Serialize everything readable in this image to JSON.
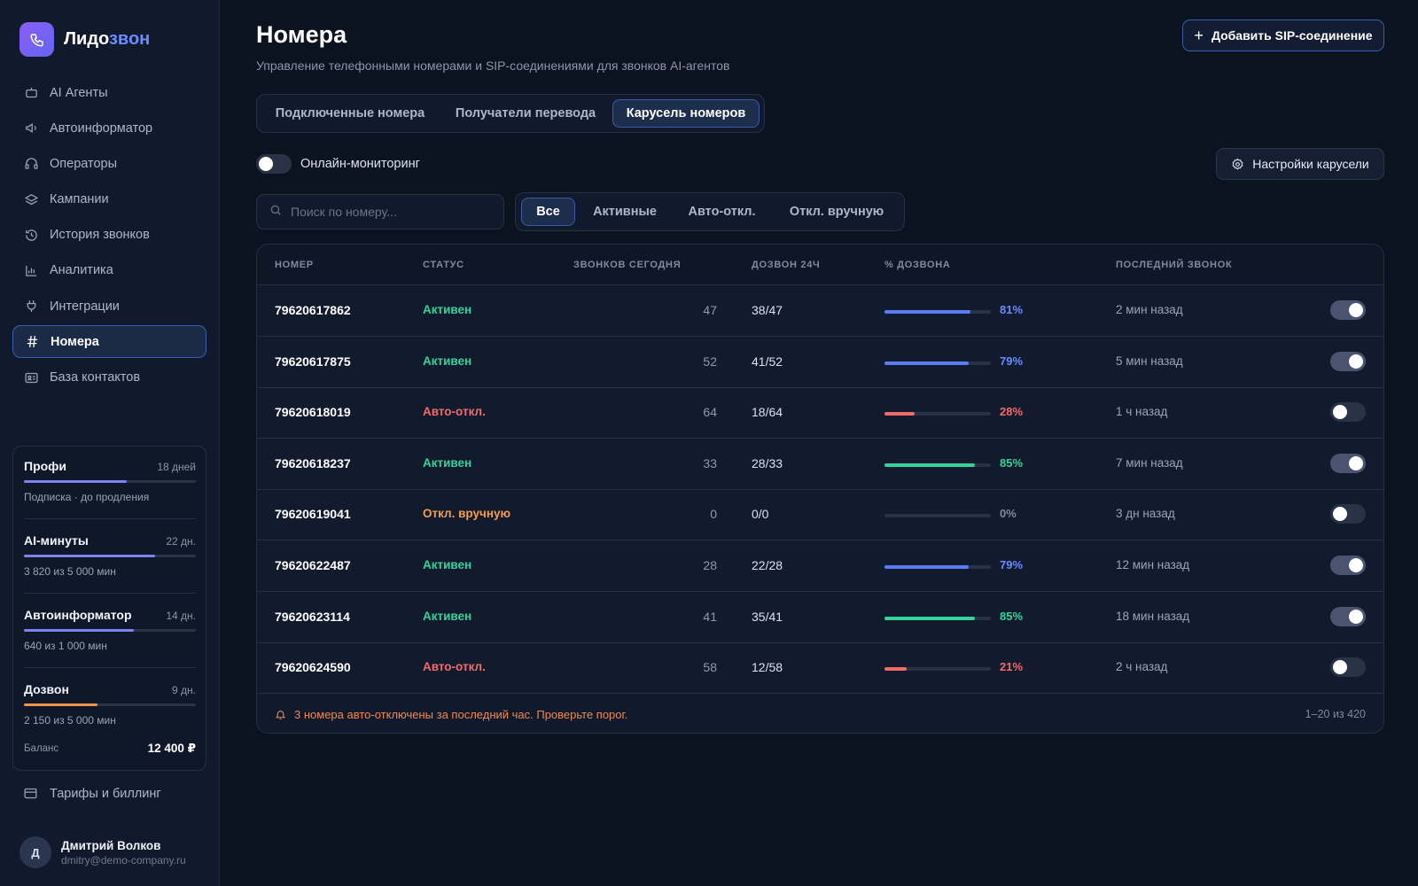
{
  "brand": {
    "name_part1": "Лидо",
    "name_part2": "звон"
  },
  "sidebar": {
    "items": [
      {
        "label": "AI Агенты",
        "icon": "robot-icon"
      },
      {
        "label": "Автоинформатор",
        "icon": "megaphone-icon"
      },
      {
        "label": "Операторы",
        "icon": "headset-icon"
      },
      {
        "label": "Кампании",
        "icon": "layers-icon"
      },
      {
        "label": "История звонков",
        "icon": "history-icon"
      },
      {
        "label": "Аналитика",
        "icon": "chart-icon"
      },
      {
        "label": "Интеграции",
        "icon": "plug-icon"
      },
      {
        "label": "Номера",
        "icon": "hash-icon",
        "active": true
      },
      {
        "label": "База контактов",
        "icon": "contact-card-icon"
      }
    ],
    "plans": [
      {
        "title": "Профи",
        "days": "18 дней",
        "sub": "Подписка · до продления",
        "progress": 0.6,
        "color": "#7c83f5"
      },
      {
        "title": "AI-минуты",
        "days": "22 дн.",
        "sub": "3 820 из 5 000 мин",
        "progress": 0.764,
        "color": "#7c83f5"
      },
      {
        "title": "Автоинформатор",
        "days": "14 дн.",
        "sub": "640 из 1 000 мин",
        "progress": 0.64,
        "color": "#7c83f5"
      },
      {
        "title": "Дозвон",
        "days": "9 дн.",
        "sub": "2 150 из 5 000 мин",
        "progress": 0.43,
        "color": "#f0934f"
      }
    ],
    "balance_label": "Баланс",
    "balance_value": "12 400 ₽",
    "billing_label": "Тарифы и биллинг",
    "user": {
      "initial": "Д",
      "name": "Дмитрий Волков",
      "email": "dmitry@demo-company.ru"
    }
  },
  "header": {
    "title": "Номера",
    "subtitle": "Управление телефонными номерами и SIP-соединениями для звонков AI-агентов",
    "add_button": "Добавить SIP-соединение",
    "settings_button": "Настройки карусели"
  },
  "tabs": [
    "Подключенные номера",
    "Получатели перевода",
    "Карусель номеров"
  ],
  "active_tab": 2,
  "monitoring": {
    "label": "Онлайн-мониторинг",
    "on": false
  },
  "search": {
    "placeholder": "Поиск по номеру..."
  },
  "filters": [
    "Все",
    "Активные",
    "Авто-откл.",
    "Откл. вручную"
  ],
  "active_filter": 0,
  "table": {
    "columns": [
      "НОМЕР",
      "СТАТУС",
      "ЗВОНКОВ СЕГОДНЯ",
      "ДОЗВОН 24Ч",
      "% ДОЗВОНА",
      "ПОСЛЕДНИЙ ЗВОНОК"
    ],
    "rows": [
      {
        "number": "79620617862",
        "status": "Активен",
        "calls": "47",
        "reach": "38/47",
        "pct": "81%",
        "pct_value": 0.81,
        "bar_color": "#5b7cf7",
        "pct_color": "#6b8bff",
        "status_color": "#34d399",
        "last": "2 мин назад",
        "enabled": true
      },
      {
        "number": "79620617875",
        "status": "Активен",
        "calls": "52",
        "reach": "41/52",
        "pct": "79%",
        "pct_value": 0.79,
        "bar_color": "#5b7cf7",
        "pct_color": "#6b8bff",
        "status_color": "#34d399",
        "last": "5 мин назад",
        "enabled": true
      },
      {
        "number": "79620618019",
        "status": "Авто-откл.",
        "calls": "64",
        "reach": "18/64",
        "pct": "28%",
        "pct_value": 0.28,
        "bar_color": "#f26b6b",
        "pct_color": "#f26b6b",
        "status_color": "#f26b6b",
        "last": "1 ч назад",
        "enabled": false
      },
      {
        "number": "79620618237",
        "status": "Активен",
        "calls": "33",
        "reach": "28/33",
        "pct": "85%",
        "pct_value": 0.85,
        "bar_color": "#34d399",
        "pct_color": "#34d399",
        "status_color": "#34d399",
        "last": "7 мин назад",
        "enabled": true
      },
      {
        "number": "79620619041",
        "status": "Откл. вручную",
        "calls": "0",
        "reach": "0/0",
        "pct": "0%",
        "pct_value": 0,
        "bar_color": "#5b7cf7",
        "pct_color": "#7f8aa0",
        "status_color": "#f59e4b",
        "last": "3 дн назад",
        "enabled": false
      },
      {
        "number": "79620622487",
        "status": "Активен",
        "calls": "28",
        "reach": "22/28",
        "pct": "79%",
        "pct_value": 0.79,
        "bar_color": "#5b7cf7",
        "pct_color": "#6b8bff",
        "status_color": "#34d399",
        "last": "12 мин назад",
        "enabled": true
      },
      {
        "number": "79620623114",
        "status": "Активен",
        "calls": "41",
        "reach": "35/41",
        "pct": "85%",
        "pct_value": 0.85,
        "bar_color": "#34d399",
        "pct_color": "#34d399",
        "status_color": "#34d399",
        "last": "18 мин назад",
        "enabled": true
      },
      {
        "number": "79620624590",
        "status": "Авто-откл.",
        "calls": "58",
        "reach": "12/58",
        "pct": "21%",
        "pct_value": 0.21,
        "bar_color": "#f26b6b",
        "pct_color": "#f26b6b",
        "status_color": "#f26b6b",
        "last": "2 ч назад",
        "enabled": false
      }
    ],
    "footer_note": "3 номера авто-отключены за последний час. Проверьте порог.",
    "footer_range": "1–20 из 420"
  }
}
